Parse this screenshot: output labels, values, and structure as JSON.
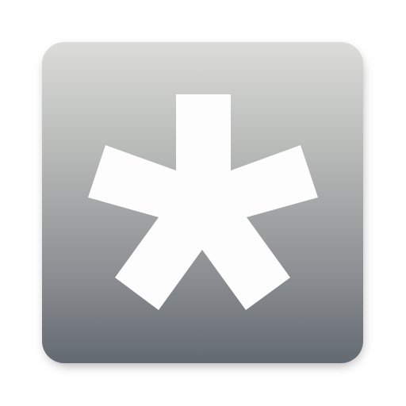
{
  "icon": {
    "name": "asterisk-icon",
    "glyph_color": "#fdfdfd",
    "background_top_color": "#dcdcd8",
    "background_bottom_color": "#646a72"
  }
}
